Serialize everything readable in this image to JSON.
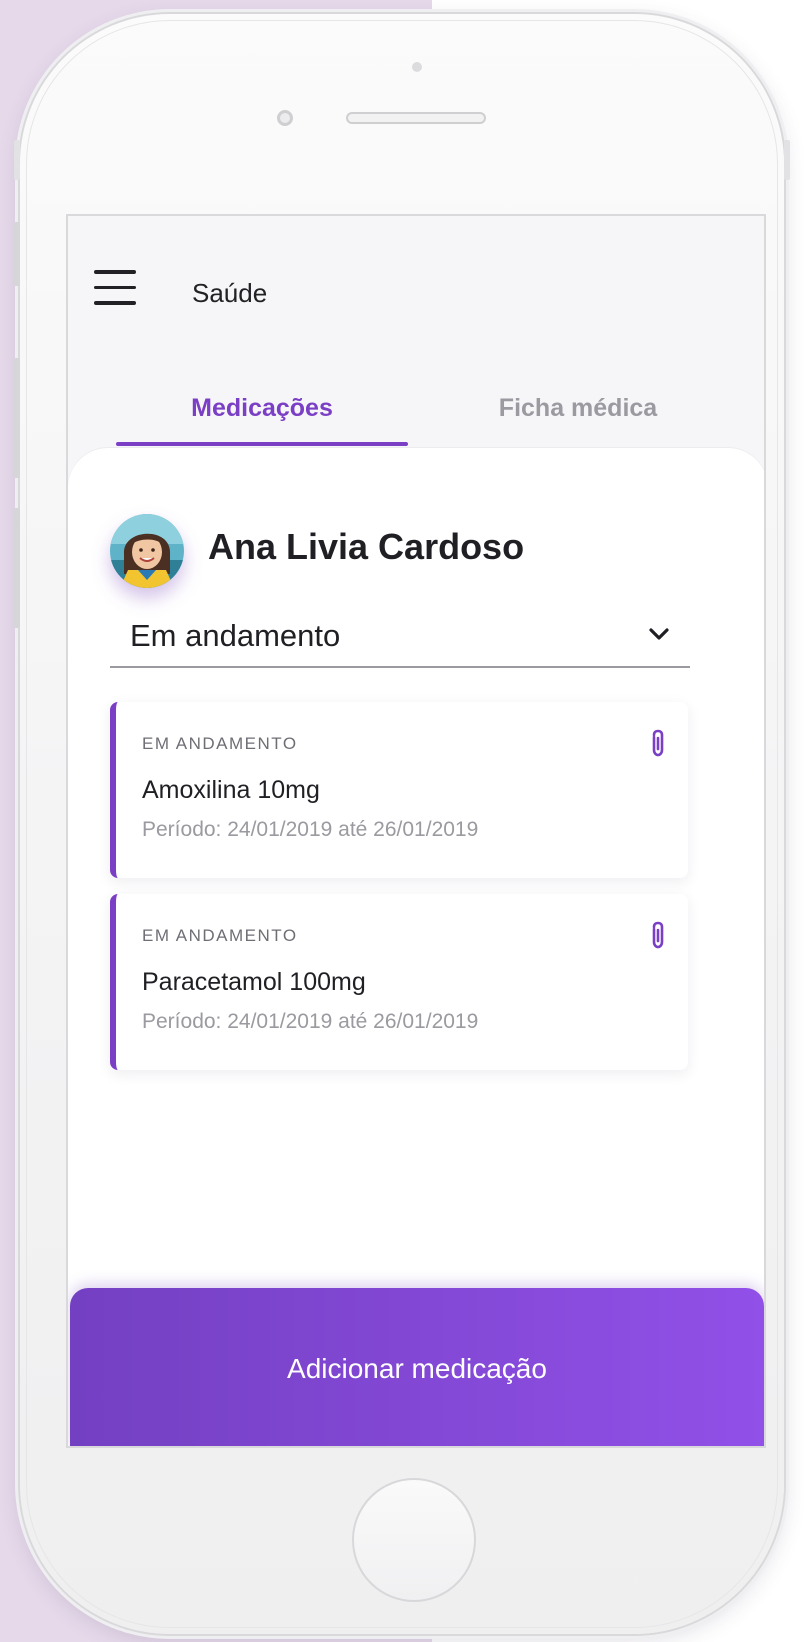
{
  "app": {
    "title": "Saúde"
  },
  "tabs": [
    {
      "label": "Medicações",
      "active": true
    },
    {
      "label": "Ficha médica",
      "active": false
    }
  ],
  "patient": {
    "name": "Ana Livia Cardoso"
  },
  "filter": {
    "selected": "Em andamento"
  },
  "medications": [
    {
      "status": "EM ANDAMENTO",
      "name": "Amoxilina 10mg",
      "period": "Período: 24/01/2019 até 26/01/2019"
    },
    {
      "status": "EM ANDAMENTO",
      "name": "Paracetamol 100mg",
      "period": "Período: 24/01/2019 até 26/01/2019"
    }
  ],
  "actions": {
    "add_label": "Adicionar medicação"
  },
  "icons": {
    "menu": "hamburger-icon",
    "dropdown": "chevron-down-icon",
    "attachment": "paperclip-icon"
  },
  "colors": {
    "accent": "#7b3fc6",
    "button_gradient_start": "#7440c2",
    "button_gradient_end": "#9150e8",
    "page_background": "#e5d9ea"
  }
}
